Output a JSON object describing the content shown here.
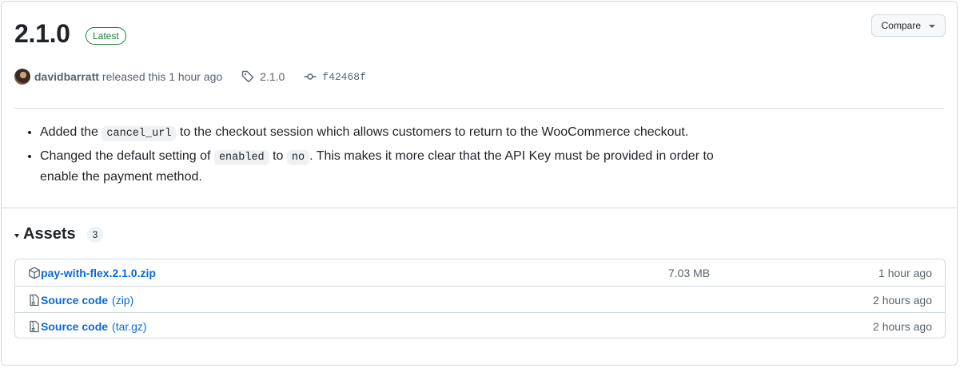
{
  "release": {
    "version": "2.1.0",
    "badge": "Latest",
    "compare_label": "Compare",
    "author": "davidbarratt",
    "released_text": "released this 1 hour ago",
    "tag": "2.1.0",
    "commit": "f42468f"
  },
  "notes": {
    "item1": {
      "before": "Added the ",
      "code": "cancel_url",
      "after": " to the checkout session which allows customers to return to the WooCommerce checkout."
    },
    "item2": {
      "before": "Changed the default setting of ",
      "code1": "enabled",
      "mid": " to ",
      "code2": "no",
      "after": ". This makes it more clear that the API Key must be provided in order to enable the payment method."
    }
  },
  "assets": {
    "title": "Assets",
    "count": "3",
    "rows": [
      {
        "name": "pay-with-flex.2.1.0.zip",
        "sub": "",
        "size": "7.03 MB",
        "time": "1 hour ago",
        "icon": "package-icon"
      },
      {
        "name": "Source code",
        "sub": "(zip)",
        "size": "",
        "time": "2 hours ago",
        "icon": "file-zip-icon"
      },
      {
        "name": "Source code",
        "sub": "(tar.gz)",
        "size": "",
        "time": "2 hours ago",
        "icon": "file-zip-icon"
      }
    ]
  },
  "colors": {
    "accent": "#0969da",
    "latest": "#1a7f37",
    "muted": "#59636e",
    "border": "#d1d9e0"
  }
}
